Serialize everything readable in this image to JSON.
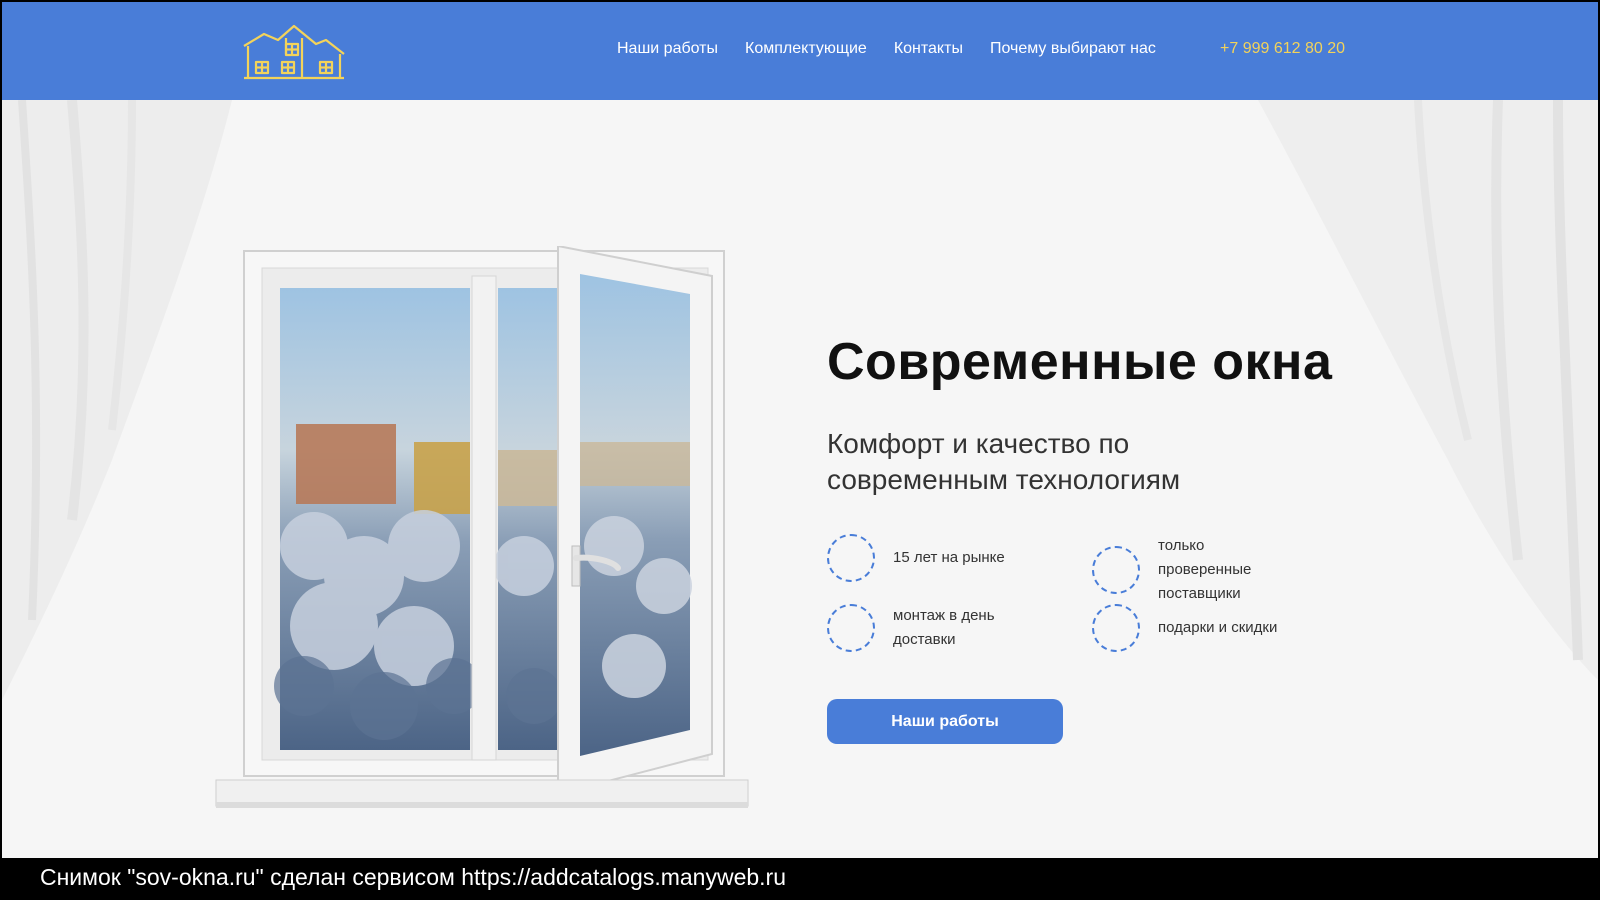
{
  "header": {
    "logo_icon": "house-windows-logo-icon",
    "nav": [
      {
        "label": "Наши работы"
      },
      {
        "label": "Комплектующие"
      },
      {
        "label": "Контакты"
      },
      {
        "label": "Почему выбирают нас"
      }
    ],
    "phone": "+7 999 612 80 20"
  },
  "hero": {
    "title": "Современные окна",
    "subtitle": "Комфорт и качество по современным технологиям",
    "features": [
      {
        "text": "15 лет на рынке"
      },
      {
        "text": "только проверенные поставщики"
      },
      {
        "text": "монтаж в день доставки"
      },
      {
        "text": "подарки и скидки"
      }
    ],
    "cta_label": "Наши работы"
  },
  "caption": "Снимок \"sov-okna.ru\" сделан сервисом https://addcatalogs.manyweb.ru",
  "colors": {
    "header_bg": "#497dd8",
    "phone": "#f3d35a",
    "accent": "#497dd8",
    "page_bg": "#f6f6f6"
  }
}
